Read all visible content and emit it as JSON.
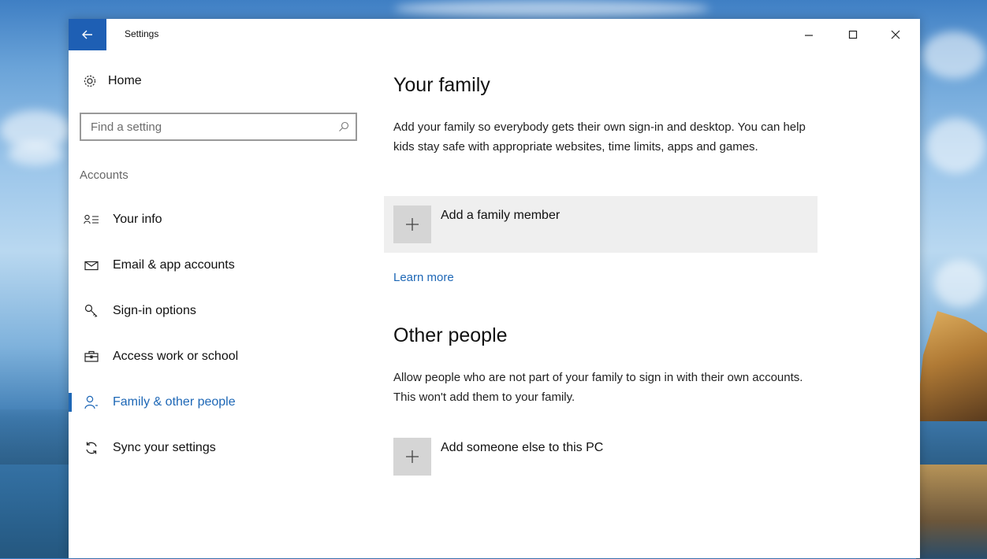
{
  "window": {
    "title": "Settings"
  },
  "titlebar": {
    "back_icon": "back-arrow-icon",
    "minimize_icon": "minimize-icon",
    "maximize_icon": "maximize-icon",
    "close_icon": "close-icon"
  },
  "sidebar": {
    "home_label": "Home",
    "home_icon": "gear-icon",
    "search": {
      "placeholder": "Find a setting",
      "icon": "search-icon"
    },
    "section_label": "Accounts",
    "items": [
      {
        "label": "Your info",
        "icon": "person-card-icon",
        "active": false
      },
      {
        "label": "Email & app accounts",
        "icon": "envelope-icon",
        "active": false
      },
      {
        "label": "Sign-in options",
        "icon": "key-icon",
        "active": false
      },
      {
        "label": "Access work or school",
        "icon": "briefcase-icon",
        "active": false
      },
      {
        "label": "Family & other people",
        "icon": "person-icon",
        "active": true
      },
      {
        "label": "Sync your settings",
        "icon": "sync-icon",
        "active": false
      }
    ]
  },
  "main": {
    "family": {
      "heading": "Your family",
      "description": "Add your family so everybody gets their own sign-in and desktop. You can help kids stay safe with appropriate websites, time limits, apps and games.",
      "add_label": "Add a family member",
      "learn_more": "Learn more"
    },
    "other": {
      "heading": "Other people",
      "description": "Allow people who are not part of your family to sign in with their own accounts. This won't add them to your family.",
      "add_label": "Add someone else to this PC"
    }
  },
  "colors": {
    "accent": "#1d67b6",
    "titlebar_back": "#1e5fb4",
    "card_bg": "#efefef",
    "plus_box": "#d5d5d5"
  }
}
